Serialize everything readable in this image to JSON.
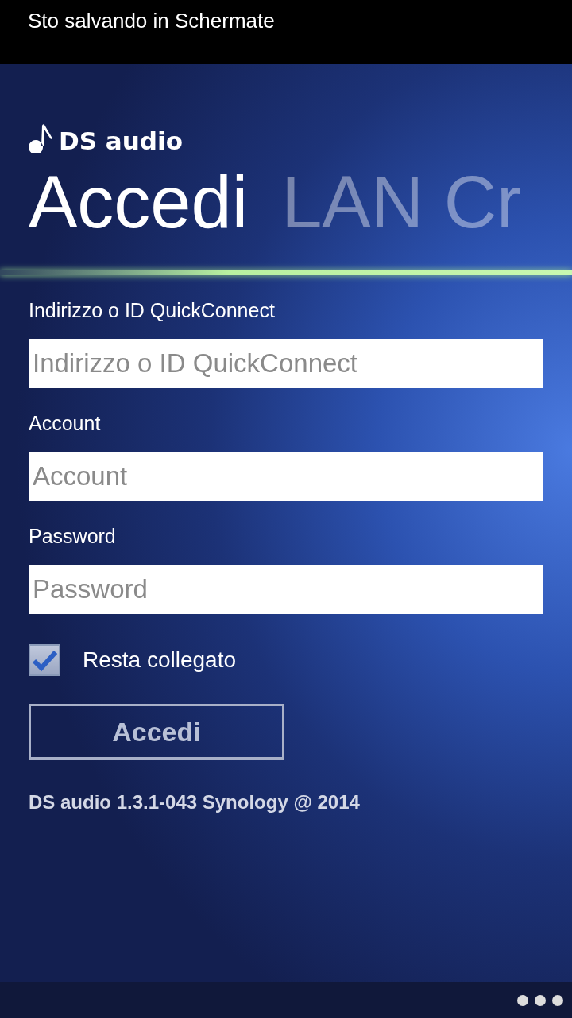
{
  "status_bar": {
    "text": "Sto salvando in Schermate"
  },
  "app": {
    "logo": "DS audio"
  },
  "pivot": [
    {
      "label": "Accedi",
      "selected": true
    },
    {
      "label": "LAN Cr",
      "selected": false
    }
  ],
  "fields": [
    {
      "label": "Indirizzo o ID QuickConnect",
      "placeholder": "Indirizzo o ID QuickConnect"
    },
    {
      "label": "Account",
      "placeholder": "Account"
    },
    {
      "label": "Password",
      "placeholder": "Password"
    }
  ],
  "remember": {
    "label": "Resta collegato",
    "checked": true
  },
  "button": "Accedi",
  "footer": "DS audio 1.3.1-043 Synology @ 2014"
}
